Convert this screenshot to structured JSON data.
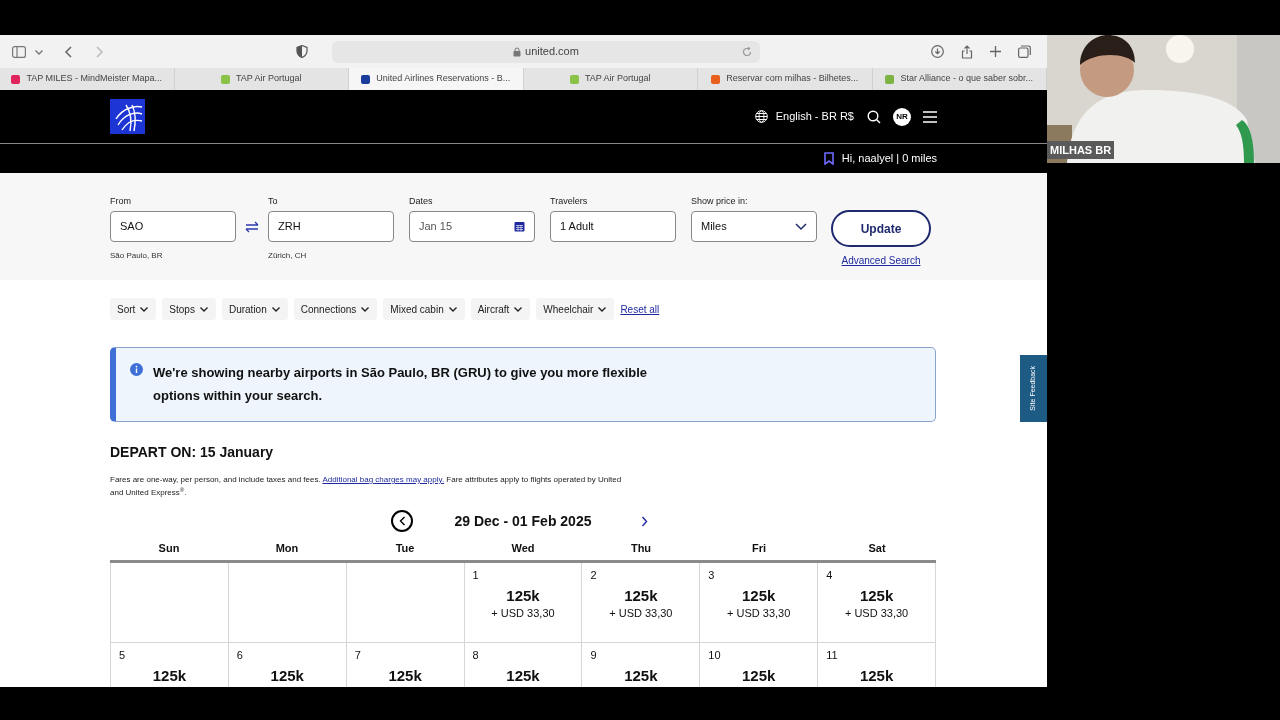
{
  "browser": {
    "url": "united.com",
    "tabs": [
      {
        "title": "TAP MILES - MindMeister Mapa...",
        "selected": false,
        "color": "#e0245e"
      },
      {
        "title": "TAP Air Portugal",
        "selected": false,
        "color": "#8bc34a"
      },
      {
        "title": "United Airlines Reservations - B...",
        "selected": true,
        "color": "#1a3d9c"
      },
      {
        "title": "TAP Air Portugal",
        "selected": false,
        "color": "#8bc34a"
      },
      {
        "title": "Reservar com milhas - Bilhetes...",
        "selected": false,
        "color": "#e8601c"
      },
      {
        "title": "Star Alliance - o que saber sobr...",
        "selected": false,
        "color": "#7cb342"
      }
    ]
  },
  "header": {
    "language": "English - BR R$",
    "avatar": "NR",
    "greeting": "Hi, naalyel | 0 miles"
  },
  "search": {
    "fields": [
      {
        "label": "From",
        "value": "SAO",
        "hint": "São Paulo, BR",
        "kind": "text"
      },
      {
        "label": "To",
        "value": "ZRH",
        "hint": "Zürich, CH",
        "kind": "text"
      },
      {
        "label": "Dates",
        "value": "Jan 15",
        "kind": "date"
      },
      {
        "label": "Travelers",
        "value": "1 Adult",
        "kind": "text"
      },
      {
        "label": "Show price in:",
        "value": "Miles",
        "kind": "select"
      }
    ],
    "update": "Update",
    "advanced": "Advanced Search"
  },
  "filters": [
    "Sort",
    "Stops",
    "Duration",
    "Connections",
    "Mixed cabin",
    "Aircraft",
    "Wheelchair"
  ],
  "reset": "Reset all",
  "notice": "We're showing nearby airports in São Paulo, BR (GRU) to give you more flexible options within your search.",
  "depart_heading": "DEPART ON: 15 January",
  "fine_print": {
    "before": "Fares are one-way, per person, and include taxes and fees.",
    "link": "Additional bag charges may apply.",
    "after": "Fare attributes apply to flights operated by United and United Express$^{®}$."
  },
  "calendar": {
    "range": "29 Dec - 01 Feb 2025",
    "weekdays": [
      "Sun",
      "Mon",
      "Tue",
      "Wed",
      "Thu",
      "Fri",
      "Sat"
    ],
    "weeks": [
      [
        {
          "kind": "empty"
        },
        {
          "kind": "empty"
        },
        {
          "kind": "empty"
        },
        {
          "kind": "fare",
          "day": "1",
          "miles": "125k",
          "cash": "+ USD 33,30"
        },
        {
          "kind": "fare",
          "day": "2",
          "miles": "125k",
          "cash": "+ USD 33,30"
        },
        {
          "kind": "fare",
          "day": "3",
          "miles": "125k",
          "cash": "+ USD 33,30"
        },
        {
          "kind": "fare",
          "day": "4",
          "miles": "125k",
          "cash": "+ USD 33,30"
        }
      ],
      [
        {
          "kind": "fare",
          "day": "5",
          "miles": "125k"
        },
        {
          "kind": "fare",
          "day": "6",
          "miles": "125k"
        },
        {
          "kind": "fare",
          "day": "7",
          "miles": "125k"
        },
        {
          "kind": "fare",
          "day": "8",
          "miles": "125k"
        },
        {
          "kind": "fare",
          "day": "9",
          "miles": "125k"
        },
        {
          "kind": "fare",
          "day": "10",
          "miles": "125k"
        },
        {
          "kind": "fare",
          "day": "11",
          "miles": "125k"
        }
      ]
    ]
  },
  "feedback": "Site Feedback",
  "webcam": {
    "kind": "picture",
    "label": "MILHAS BR"
  }
}
